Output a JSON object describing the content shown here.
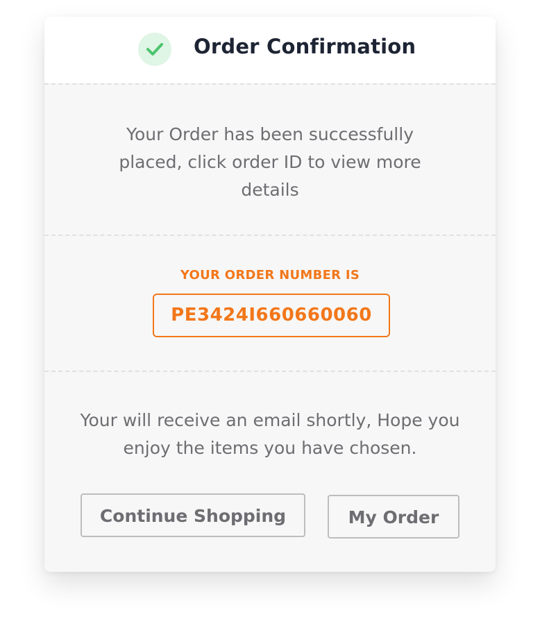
{
  "header": {
    "title": "Order Confirmation",
    "icon": "check-icon",
    "icon_color": "#4cc46e",
    "icon_bg": "#dff5e5"
  },
  "message": {
    "success": "Your Order has been successfully placed, click order ID to view more details"
  },
  "order": {
    "label": "YOUR ORDER NUMBER IS",
    "number": "PE3424I660660060",
    "accent_color": "#f2771a"
  },
  "footer": {
    "email_note": "Your will receive an email shortly, Hope you enjoy the items you have chosen."
  },
  "actions": {
    "continue_label": "Continue Shopping",
    "my_order_label": "My Order"
  }
}
